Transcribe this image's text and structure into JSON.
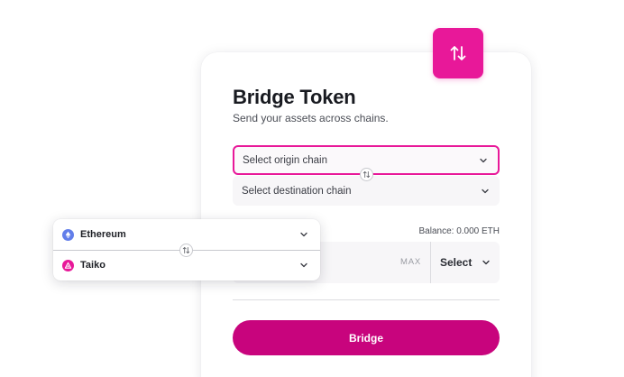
{
  "card": {
    "title": "Bridge Token",
    "subtitle": "Send your assets across chains.",
    "origin_placeholder": "Select origin chain",
    "destination_placeholder": "Select destination chain",
    "balance": "Balance: 0.000 ETH",
    "max_label": "MAX",
    "token_select_label": "Select",
    "bridge_label": "Bridge"
  },
  "chain_card": {
    "items": [
      {
        "name": "Ethereum",
        "icon": "ethereum-icon"
      },
      {
        "name": "Taiko",
        "icon": "taiko-icon"
      }
    ]
  },
  "icons": {
    "swap_badge": "swap-arrows-icon",
    "mini_swap": "swap-arrows-icon",
    "dropdown": "chevron-down-icon"
  },
  "colors": {
    "accent": "#e81899",
    "bridge_button": "#c8047d",
    "ethereum": "#627eea",
    "taiko": "#e81899"
  }
}
